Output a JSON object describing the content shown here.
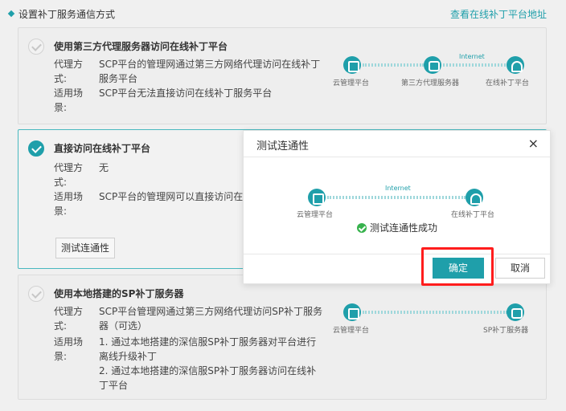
{
  "header": {
    "title": "设置补丁服务通信方式",
    "link": "查看在线补丁平台地址"
  },
  "cards": [
    {
      "title": "使用第三方代理服务器访问在线补丁平台",
      "proxy_label": "代理方式:",
      "proxy_value": "SCP平台的管理网通过第三方网络代理访问在线补丁服务平台",
      "scene_label": "适用场景:",
      "scene_value": "SCP平台无法直接访问在线补丁服务平台",
      "diagram": {
        "internet": "Internet",
        "nodes": [
          "云管理平台",
          "第三方代理服务器",
          "在线补丁平台"
        ]
      }
    },
    {
      "title": "直接访问在线补丁平台",
      "proxy_label": "代理方式:",
      "proxy_value": "无",
      "scene_label": "适用场景:",
      "scene_value": "SCP平台的管理网可以直接访问在",
      "test_button": "测试连通性"
    },
    {
      "title": "使用本地搭建的SP补丁服务器",
      "proxy_label": "代理方式:",
      "proxy_value": "SCP平台管理网通过第三方网络代理访问SP补丁服务器（可选）",
      "scene_label": "适用场景:",
      "scene_value_1": "1. 通过本地搭建的深信服SP补丁服务器对平台进行离线升级补丁",
      "scene_value_2": "2. 通过本地搭建的深信服SP补丁服务器访问在线补丁平台",
      "diagram": {
        "nodes": [
          "云管理平台",
          "SP补丁服务器"
        ]
      }
    }
  ],
  "modal": {
    "title": "测试连通性",
    "close": "×",
    "internet": "Internet",
    "nodes": [
      "云管理平台",
      "在线补丁平台"
    ],
    "success": "测试连通性成功",
    "ok": "确定",
    "cancel": "取消"
  },
  "colors": {
    "accent": "#1f9faa",
    "success": "#37b24d",
    "highlight": "#ff1d1d"
  }
}
